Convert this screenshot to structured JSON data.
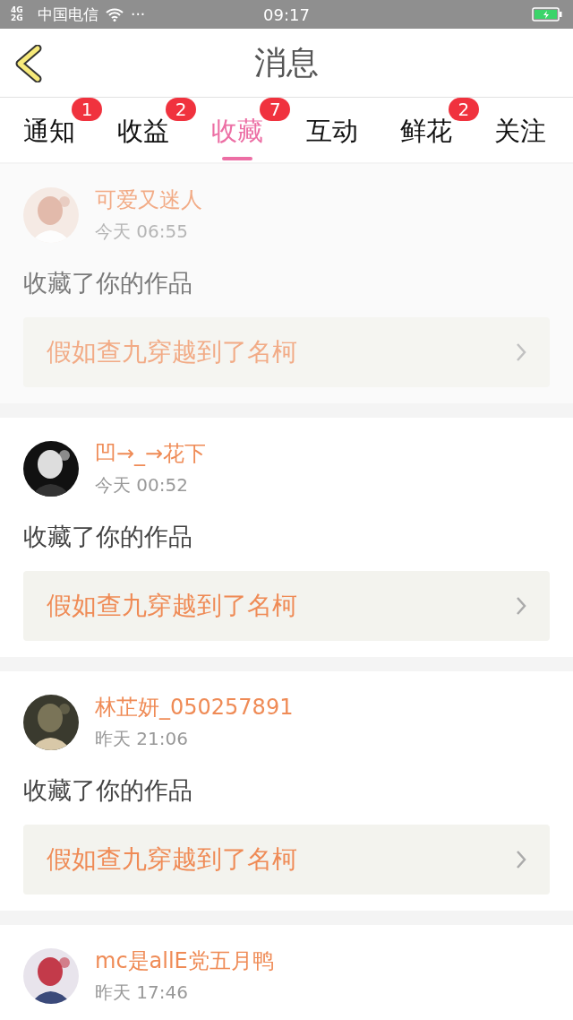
{
  "status_bar": {
    "network": "4G 2G",
    "carrier": "中国电信",
    "more": "···",
    "time": "09:17"
  },
  "header": {
    "title": "消息"
  },
  "tabs": [
    {
      "label": "通知",
      "badge": "1",
      "selected": false
    },
    {
      "label": "收益",
      "badge": "2",
      "selected": false
    },
    {
      "label": "收藏",
      "badge": "7",
      "selected": true
    },
    {
      "label": "互动",
      "selected": false
    },
    {
      "label": "鲜花",
      "badge": "2",
      "selected": false
    },
    {
      "label": "关注",
      "selected": false
    }
  ],
  "messages": [
    {
      "faded": true,
      "name": "可爱又迷人",
      "time": "今天 06:55",
      "action": "收藏了你的作品",
      "work": "假如查九穿越到了名柯"
    },
    {
      "faded": false,
      "name": "凹→_→花下",
      "time": "今天 00:52",
      "action": "收藏了你的作品",
      "work": "假如查九穿越到了名柯"
    },
    {
      "faded": false,
      "name": "林芷妍_050257891",
      "time": "昨天 21:06",
      "action": "收藏了你的作品",
      "work": "假如查九穿越到了名柯"
    },
    {
      "faded": false,
      "name": "mc是allE党五月鸭",
      "time": "昨天 17:46"
    }
  ]
}
